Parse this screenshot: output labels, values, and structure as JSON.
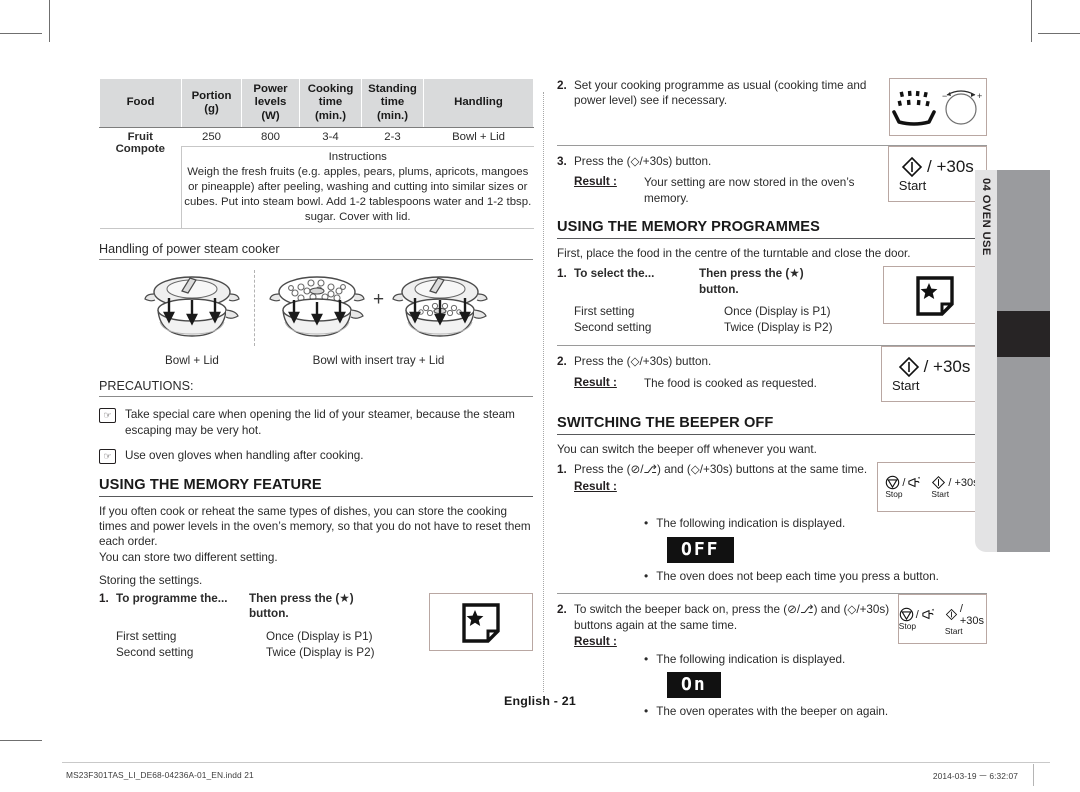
{
  "side_tab": {
    "label": "04  OVEN USE"
  },
  "page_number": "English - 21",
  "footer": {
    "file": "MS23F301TAS_LI_DE68-04236A-01_EN.indd   21",
    "timestamp": "2014-03-19   ㅡ 6:32:07"
  },
  "table": {
    "headers": [
      "Food",
      "Portion (g)",
      "Power levels (W)",
      "Cooking time (min.)",
      "Standing time (min.)",
      "Handling"
    ],
    "header_lines": {
      "food": [
        "Food"
      ],
      "portion": [
        "Portion",
        "(g)"
      ],
      "power": [
        "Power",
        "levels",
        "(W)"
      ],
      "cooking": [
        "Cooking",
        "time",
        "(min.)"
      ],
      "standing": [
        "Standing",
        "time",
        "(min.)"
      ],
      "handling": [
        "Handling"
      ]
    },
    "row": {
      "food_line1": "Fruit",
      "food_line2": "Compote",
      "portion": "250",
      "power": "800",
      "cooking": "3-4",
      "standing": "2-3",
      "handling": "Bowl + Lid"
    },
    "instructions_label": "Instructions",
    "instructions_text": "Weigh the fresh fruits (e.g. apples, pears, plums, apricots, mangoes or pineapple) after peeling, washing and cutting into similar sizes or cubes. Put into steam bowl. Add 1-2 tablespoons water and 1-2 tbsp. sugar. Cover with lid."
  },
  "steamer": {
    "heading": "Handling of power steam cooker",
    "caption_left": "Bowl + Lid",
    "caption_right": "Bowl with insert tray + Lid",
    "plus": "+"
  },
  "precautions": {
    "title": "PRECAUTIONS:",
    "items": [
      "Take special care when opening the lid of your steamer, because the steam escaping may be very hot.",
      "Use oven gloves when handling after cooking."
    ]
  },
  "memory_feature": {
    "heading": "USING THE MEMORY FEATURE",
    "intro": "If you often cook or reheat the same types of dishes, you can store the cooking times and power levels in the oven’s memory, so that you do not have to reset them each order.",
    "intro2": "You can store two different setting.",
    "storing": "Storing the settings.",
    "step1_num": "1.",
    "step1_text": "To programme the...",
    "step1_press_line1": "Then press the (★) ",
    "step1_press_line2": "button.",
    "rows": [
      {
        "label": "First setting",
        "value": "Once (Display is P1)"
      },
      {
        "label": "Second setting",
        "value": "Twice (Display is P2)"
      }
    ]
  },
  "right_top": {
    "step2_num": "2.",
    "step2_text": "Set your cooking programme as usual (cooking time and power level) see if necessary.",
    "step3_num": "3.",
    "step3_text_pre": "Press the (",
    "step3_text_post": ") button.",
    "step3_btn": "◇/+30s",
    "result_label": "Result :",
    "step3_result": "Your setting are now stored in the oven’s memory."
  },
  "memory_programmes": {
    "heading": "USING THE MEMORY PROGRAMMES",
    "intro": "First, place the food in the centre of the turntable and close the door.",
    "step1_num": "1.",
    "step1_text": "To select the...",
    "step1_press_line1": "Then press the (★) ",
    "step1_press_line2": "button.",
    "rows": [
      {
        "label": "First setting",
        "value": "Once (Display is P1)"
      },
      {
        "label": "Second setting",
        "value": "Twice (Display is P2)"
      }
    ],
    "step2_num": "2.",
    "step2_text_pre": "Press the (",
    "step2_text_post": ") button.",
    "result_label": "Result :",
    "step2_result": "The food is cooked as requested."
  },
  "beeper": {
    "heading": "SWITCHING THE BEEPER OFF",
    "intro": "You can switch the beeper off whenever you want.",
    "step1_num": "1.",
    "step1_text": "Press the (⊘/⎇) and (◇/+30s) buttons at the same time.",
    "result_label": "Result :",
    "step1_bullet1": "The following indication is displayed.",
    "display_off": "OFF",
    "step1_bullet2": "The oven does not beep each time you press a button.",
    "step2_num": "2.",
    "step2_text": "To switch the beeper back on, press the (⊘/⎇) and (◇/+30s) buttons again at the same time.",
    "step2_bullet1": "The following indication is displayed.",
    "display_on": "On",
    "step2_bullet2": "The oven operates with the beeper on again.",
    "stop_label": "Stop",
    "start_label": "Start"
  },
  "icons": {
    "start_symbol": "◇",
    "start_plus30": "/ +30s",
    "start_word": "Start",
    "memo_star": "★"
  },
  "colors": {
    "table_header_bg": "#d9dadb",
    "side_tab_bg": "#e3e3e4",
    "sidebar_grey": "#9a9b9e",
    "sidebar_black": "#272425",
    "lcd_bg": "#111111",
    "rule": "#58595b"
  }
}
